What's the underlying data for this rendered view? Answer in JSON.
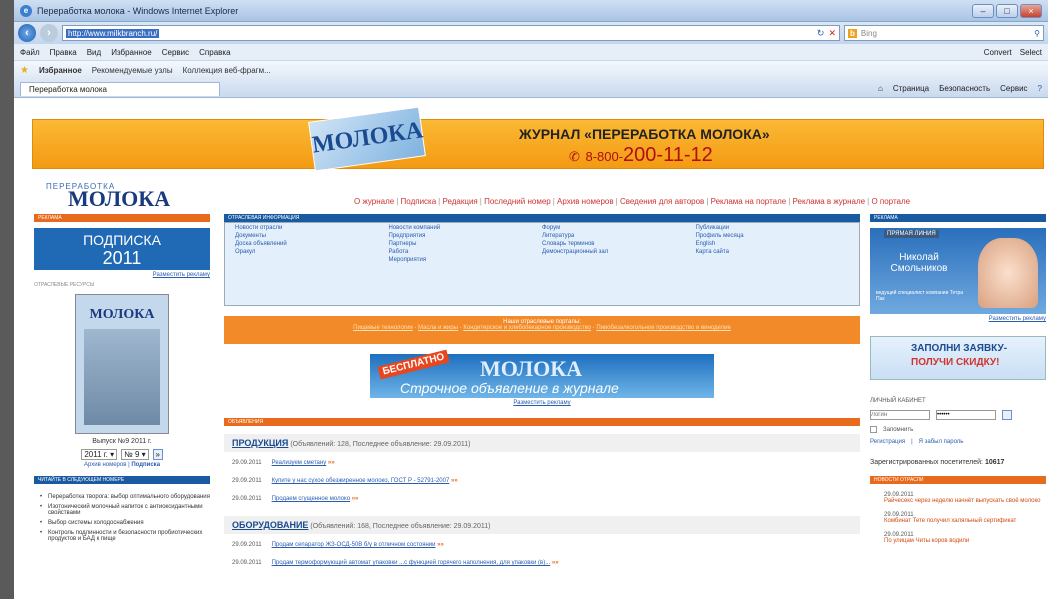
{
  "window": {
    "title": "Переработка молока - Windows Internet Explorer",
    "controls": [
      "–",
      "□",
      "×"
    ]
  },
  "address": {
    "url": "http://www.milkbranch.ru/",
    "search_placeholder": "Bing",
    "search_brand": "b"
  },
  "menu": {
    "items": [
      "Файл",
      "Правка",
      "Вид",
      "Избранное",
      "Сервис",
      "Справка"
    ],
    "right": [
      "Convert",
      "Select"
    ]
  },
  "favorites": {
    "label": "Избранное",
    "items": [
      "Рекомендуемые узлы",
      "Коллекция веб-фрагм..."
    ]
  },
  "tabs": {
    "active": "Переработка молока",
    "tools": [
      "Страница",
      "Безопасность",
      "Сервис"
    ]
  },
  "banner": {
    "logo_small": "ПЕРЕРАБОТКА",
    "logo": "МОЛОКА",
    "title": "ЖУРНАЛ «ПЕРЕРАБОТКА МОЛОКА»",
    "phone_prefix": "8-800-",
    "phone": "200-11-12"
  },
  "site_logo": {
    "small": "ПЕРЕРАБОТКА",
    "big": "МОЛОКА"
  },
  "topnav": [
    "О журнале",
    "Подписка",
    "Редакция",
    "Последний номер",
    "Архив номеров",
    "Сведения для авторов",
    "Реклама на портале",
    "Реклама в журнале",
    "О портале"
  ],
  "left": {
    "ad_header": "РЕКЛАМА",
    "subscribe": {
      "l1": "ПОДПИСКА",
      "l2": "2011"
    },
    "place_ad": "Разместить рекламу",
    "print_label": "ОТРАСЛЕВЫЕ РЕСУРСЫ",
    "mag_title": "МОЛОКА",
    "issue": "Выпуск №9 2011 г.",
    "year": "2011 г.",
    "num": "№ 9",
    "archive": "Архив номеров",
    "subscr": "Подписка",
    "read_header": "ЧИТАЙТЕ В СЛЕДУЮЩЕМ НОМЕРЕ",
    "reads": [
      "Переработка творога: выбор оптимального оборудования",
      "Изотонический молочный напиток с антиоксидантными свойствами",
      "Выбор системы холодоснабжения",
      "Контроль подлинности и безопасности пробиотических продуктов и БАД к пище"
    ]
  },
  "center": {
    "info_header": "ОТРАСЛЕВАЯ ИНФОРМАЦИЯ",
    "info_cols": [
      [
        "Новости отрасли",
        "Документы",
        "Доска объявлений",
        "Оракул"
      ],
      [
        "Новости компаний",
        "Предприятия",
        "Партнеры",
        "Работа",
        "Мероприятия"
      ],
      [
        "Форум",
        "Литература",
        "Словарь терминов",
        "Демонстрационный зал"
      ],
      [
        "Публикации",
        "Профиль месяца",
        "English",
        "Карта сайта"
      ]
    ],
    "portals_title": "Наши отраслевые порталы:",
    "portals": [
      "Пищевые технологии",
      "Масла и жиры",
      "Кондитерское и хлебопекарное производство",
      "Пивобезалкогольное производство и виноделие"
    ],
    "ad": {
      "stamp": "БЕСПЛАТНО",
      "logo": "МОЛОКА",
      "text": "Строчное объявление в журнале"
    },
    "ad_link": "Разместить рекламу",
    "ads_header": "ОБЪЯВЛЕНИЯ",
    "cats": [
      {
        "name": "ПРОДУКЦИЯ",
        "meta": "(Объявлений: 128, Последнее объявление: 29.09.2011)",
        "rows": [
          {
            "date": "29.09.2011",
            "text": "Реализуем сметану"
          },
          {
            "date": "29.09.2011",
            "text": "Купите у нас сухое обезжиренное молоко, ГОСТ Р - 52791-2007"
          },
          {
            "date": "29.09.2011",
            "text": "Продаем сгущенное молоко"
          }
        ]
      },
      {
        "name": "ОБОРУДОВАНИЕ",
        "meta": "(Объявлений: 168, Последнее объявление: 29.09.2011)",
        "rows": [
          {
            "date": "29.09.2011",
            "text": "Продам сепаратор ЖЗ-ОСД-50В б/у в отличном состоянии"
          },
          {
            "date": "29.09.2011",
            "text": "Продам термоформующий автомат упаковки ...с функцией горячего наполнения, для упаковки (в)..."
          }
        ]
      }
    ],
    "new_mark": "»»"
  },
  "right": {
    "ad_header": "РЕКЛАМА",
    "person": {
      "hd": "ПРЯМАЯ ЛИНИЯ",
      "name": "Николай Смольников",
      "desc": "ведущий специалист компании Тетра Пак"
    },
    "place_ad": "Разместить рекламу",
    "fill1": "ЗАПОЛНИ ЗАЯВКУ-",
    "fill2": "ПОЛУЧИ СКИДКУ!",
    "cabinet": "ЛИЧНЫЙ КАБИНЕТ",
    "login_placeholder": "Логин",
    "pass": "••••••",
    "remember": "Запомнить",
    "register": "Регистрация",
    "forgot": "Я забыл пароль",
    "reg_label": "Зарегистрированных посетителей:",
    "reg_count": "10617",
    "news_header": "НОВОСТИ ОТРАСЛИ",
    "news": [
      {
        "date": "29.09.2011",
        "title": "Райчесекс через неделю начнёт выпускать своё молоко"
      },
      {
        "date": "29.09.2011",
        "title": "Комбинат Тете получил халяльный сертификат"
      },
      {
        "date": "29.09.2011",
        "title": "По улицам Читы коров водили"
      }
    ]
  }
}
